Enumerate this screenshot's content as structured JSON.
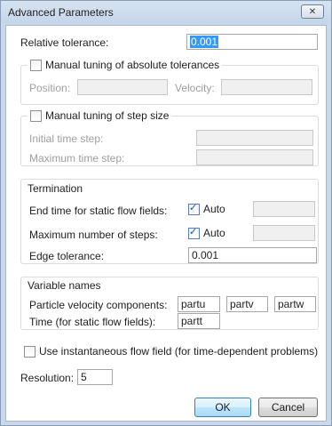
{
  "window": {
    "title": "Advanced Parameters",
    "close_glyph": "✕"
  },
  "relative_tolerance": {
    "label": "Relative tolerance:",
    "value": "0.001"
  },
  "abs_tol_group": {
    "label": "Manual tuning of absolute tolerances",
    "checked": false,
    "position_label": "Position:",
    "position_value": "",
    "velocity_label": "Velocity:",
    "velocity_value": ""
  },
  "step_size_group": {
    "label": "Manual tuning of step size",
    "checked": false,
    "initial_label": "Initial time step:",
    "initial_value": "",
    "maximum_label": "Maximum time step:",
    "maximum_value": ""
  },
  "termination": {
    "title": "Termination",
    "end_time_label": "End time for static flow fields:",
    "end_time_auto_label": "Auto",
    "end_time_auto_checked": true,
    "end_time_value": "",
    "max_steps_label": "Maximum number of steps:",
    "max_steps_auto_label": "Auto",
    "max_steps_auto_checked": true,
    "max_steps_value": "",
    "edge_tol_label": "Edge tolerance:",
    "edge_tol_value": "0.001"
  },
  "variable_names": {
    "title": "Variable names",
    "velocity_label": "Particle velocity components:",
    "u": "partu",
    "v": "partv",
    "w": "partw",
    "time_label": "Time (for static flow fields):",
    "t": "partt"
  },
  "instantaneous": {
    "label": "Use instantaneous flow field (for time-dependent problems)",
    "checked": false
  },
  "resolution": {
    "label": "Resolution:",
    "value": "5"
  },
  "buttons": {
    "ok": "OK",
    "cancel": "Cancel"
  },
  "colors": {
    "title_bar": "#c9d8ea",
    "selection": "#3399ff",
    "default_button": "#bee6fd",
    "disabled_text": "#9e9e9e"
  },
  "icons": {
    "close": "close-icon",
    "check": "check-icon"
  }
}
